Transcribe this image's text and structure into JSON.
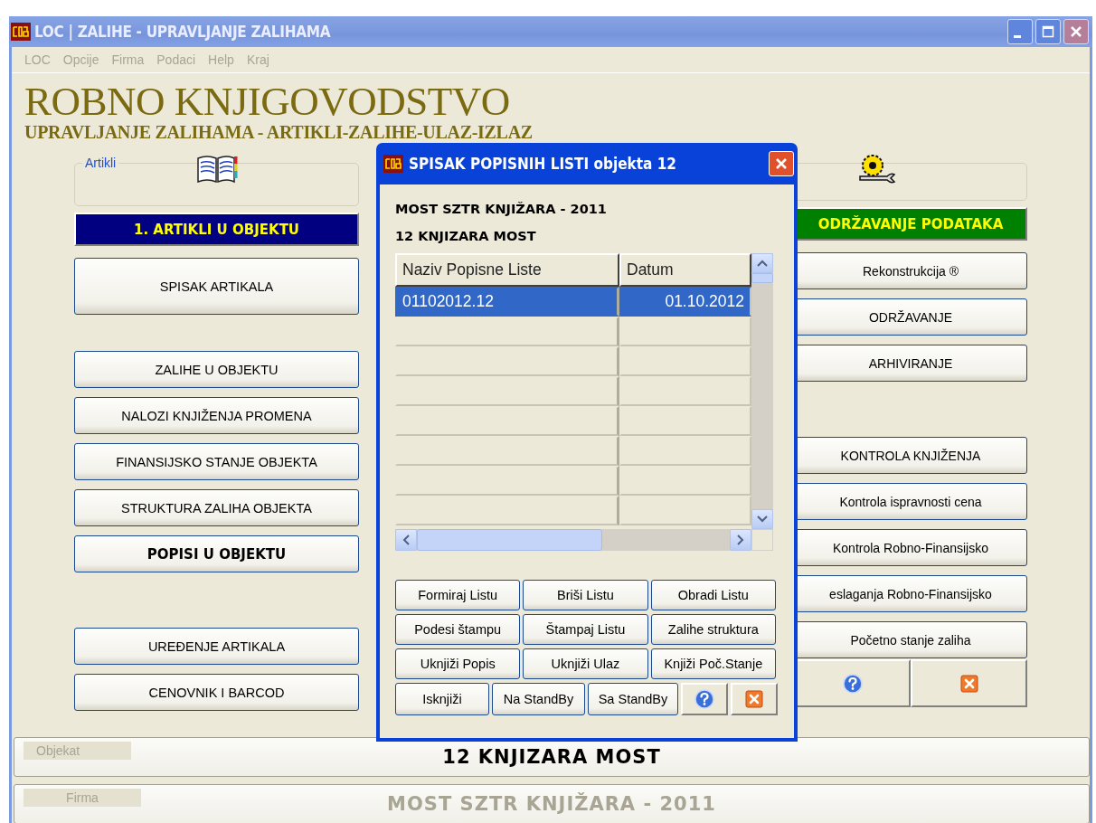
{
  "window": {
    "title": "LOC | ZALIHE - UPRAVLJANJE ZALIHAMA"
  },
  "menu": [
    "LOC",
    "Opcije",
    "Firma",
    "Podaci",
    "Help",
    "Kraj"
  ],
  "header": {
    "title": "ROBNO KNJIGOVODSTVO",
    "subtitle": "UPRAVLJANJE ZALIHAMA - ARTIKLI-ZALIHE-ULAZ-IZLAZ"
  },
  "left_panel": {
    "group_label": "Artikli",
    "heading": "1. ARTIKLI U OBJEKTU",
    "button_groups": [
      [
        {
          "label": "SPISAK ARTIKALA",
          "bold": false,
          "kind": "tall"
        }
      ],
      [
        {
          "label": "ZALIHE U OBJEKTU",
          "bold": false,
          "kind": "normal"
        },
        {
          "label": "NALOZI KNJIŽENJA PROMENA",
          "bold": false,
          "kind": "normal"
        },
        {
          "label": "FINANSIJSKO STANJE OBJEKTA",
          "bold": false,
          "kind": "normal"
        },
        {
          "label": "STRUKTURA ZALIHA OBJEKTA",
          "bold": false,
          "kind": "normal"
        },
        {
          "label": "POPISI U OBJEKTU",
          "bold": true,
          "kind": "normal"
        }
      ],
      [
        {
          "label": "UREĐENJE ARTIKALA",
          "bold": false,
          "kind": "normal"
        },
        {
          "label": "CENOVNIK I BARCOD",
          "bold": false,
          "kind": "normal"
        }
      ]
    ]
  },
  "right_panel": {
    "heading": "ODRŽAVANJE PODATAKA",
    "button_groups": [
      [
        {
          "label": "Rekonstrukcija ®",
          "bold": false
        },
        {
          "label": "ODRŽAVANJE",
          "bold": false
        },
        {
          "label": "ARHIVIRANJE",
          "bold": false
        }
      ],
      [
        {
          "label": "KONTROLA KNJIŽENJA",
          "bold": false
        },
        {
          "label": "Kontrola ispravnosti cena",
          "bold": false
        },
        {
          "label": "Kontrola Robno-Finansijsko",
          "bold": false
        },
        {
          "label": "eslaganja Robno-Finansijsko",
          "bold": false
        },
        {
          "label": "Početno stanje zaliha",
          "bold": false
        }
      ]
    ],
    "icon_buttons": [
      {
        "kind": "help"
      },
      {
        "kind": "close"
      }
    ]
  },
  "status_rows": [
    {
      "label": "Objekat",
      "value": "12 KNJIZARA MOST",
      "disabled": false
    },
    {
      "label": "Firma",
      "value": "MOST SZTR KNJIŽARA - 2011",
      "disabled": true
    }
  ],
  "dialog": {
    "title": "SPISAK POPISNIH LISTI objekta 12",
    "company": "MOST SZTR KNJIŽARA - 2011",
    "object": "12 KNJIZARA MOST",
    "table": {
      "columns": [
        "Naziv Popisne Liste",
        "Datum"
      ],
      "rows": [
        {
          "cells": [
            "01102012.12",
            "01.10.2012"
          ],
          "selected": true
        }
      ]
    },
    "button_rows": [
      [
        {
          "kind": "text",
          "label": "Formiraj Listu"
        },
        {
          "kind": "text",
          "label": "Briši Listu"
        },
        {
          "kind": "text",
          "label": "Obradi Listu"
        }
      ],
      [
        {
          "kind": "text",
          "label": "Podesi štampu"
        },
        {
          "kind": "text",
          "label": "Štampaj Listu"
        },
        {
          "kind": "text",
          "label": "Zalihe struktura"
        }
      ],
      [
        {
          "kind": "text",
          "label": "Uknjiži Popis"
        },
        {
          "kind": "text",
          "label": "Uknjiži Ulaz"
        },
        {
          "kind": "text",
          "label": "Knjiži Poč.Stanje"
        }
      ],
      [
        {
          "kind": "text",
          "label": "Isknjiži"
        },
        {
          "kind": "text",
          "label": "Na StandBy"
        },
        {
          "kind": "text",
          "label": "Sa StandBy"
        },
        {
          "kind": "help"
        },
        {
          "kind": "close"
        }
      ]
    ]
  }
}
